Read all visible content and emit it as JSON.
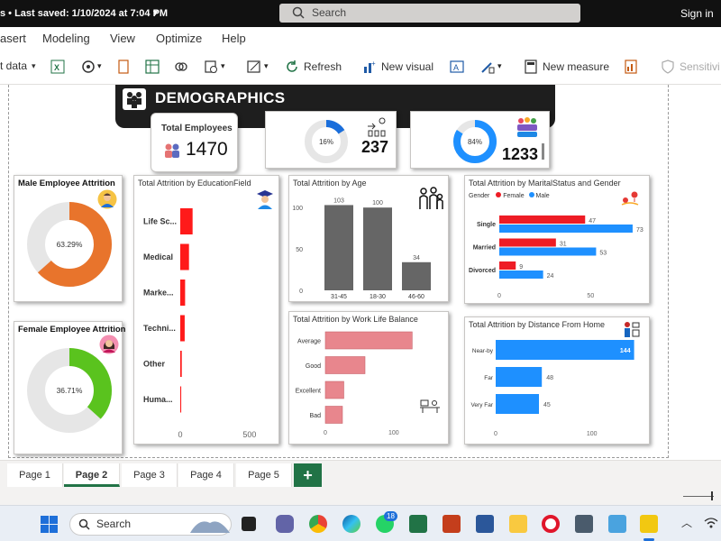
{
  "titlebar": {
    "saved_text": "s  •  Last saved: 1/10/2024 at 7:04 PM",
    "search_placeholder": "Search",
    "signin": "Sign in"
  },
  "menu": [
    "asert",
    "Modeling",
    "View",
    "Optimize",
    "Help"
  ],
  "ribbon": {
    "get_data": "t data",
    "refresh": "Refresh",
    "new_visual": "New visual",
    "new_measure": "New measure",
    "sensitivity": "Sensitivi"
  },
  "banner": {
    "title": "DEMOGRAPHICS"
  },
  "kpis": {
    "total_employees_label": "Total Employees",
    "total_employees_value": "1470",
    "attrition_count": "237",
    "attrition_pct": "16%",
    "active_count": "1233",
    "active_pct": "84%"
  },
  "colors": {
    "male": "#e8742c",
    "female": "#5ac31e",
    "education": "#ff1a1a",
    "age": "#666666",
    "worklife": "#e8868d",
    "distance": "#1e90ff",
    "marital_female": "#ee1c25",
    "marital_male": "#1e90ff",
    "donut_bg": "#e6e6e6",
    "kpi_blue": "#1a6edb",
    "kpi_blue2": "#1e90ff"
  },
  "male_attrition": {
    "title": "Male Employee Attrition",
    "value_label": "63.29%",
    "value": 63.29
  },
  "female_attrition": {
    "title": "Female Employee Attrition",
    "value_label": "36.71%",
    "value": 36.71
  },
  "chart_data": [
    {
      "type": "bar",
      "title": "Total Attrition by EducationField",
      "orientation": "horizontal",
      "categories": [
        "Life Sc...",
        "Medical",
        "Marke...",
        "Techni...",
        "Other",
        "Huma..."
      ],
      "values": [
        89,
        63,
        35,
        32,
        11,
        7
      ],
      "xticks": [
        "0",
        "500"
      ],
      "xlim": [
        0,
        650
      ]
    },
    {
      "type": "bar",
      "title": "Total Attrition by Age",
      "categories": [
        "31-45",
        "18-30",
        "46-60"
      ],
      "values": [
        103,
        100,
        34
      ],
      "yticks": [
        "0",
        "50",
        "100"
      ],
      "ylim": [
        0,
        110
      ]
    },
    {
      "type": "bar",
      "title": "Total Attrition by Work Life Balance",
      "orientation": "horizontal",
      "categories": [
        "Average",
        "Good",
        "Excellent",
        "Bad"
      ],
      "values": [
        127,
        58,
        27,
        25
      ],
      "xticks": [
        "0",
        "100"
      ],
      "xlim": [
        0,
        145
      ]
    },
    {
      "type": "bar",
      "title": "Total Attrition by MaritalStatus and Gender",
      "orientation": "horizontal",
      "legend_title": "Gender",
      "categories": [
        "Single",
        "Married",
        "Divorced"
      ],
      "series": [
        {
          "name": "Female",
          "values": [
            47,
            31,
            9
          ]
        },
        {
          "name": "Male",
          "values": [
            73,
            53,
            24
          ]
        }
      ],
      "xticks": [
        "0",
        "50"
      ],
      "xlim": [
        0,
        75
      ]
    },
    {
      "type": "bar",
      "title": "Total Attrition by Distance From Home",
      "orientation": "horizontal",
      "categories": [
        "Near-by",
        "Far",
        "Very Far"
      ],
      "values": [
        144,
        48,
        45
      ],
      "xticks": [
        "0",
        "100"
      ],
      "xlim": [
        0,
        150
      ]
    }
  ],
  "pages": [
    "Page 1",
    "Page 2",
    "Page 3",
    "Page 4",
    "Page 5"
  ],
  "active_page": "Page 2",
  "taskbar": {
    "search": "Search",
    "whatsapp_badge": "18"
  }
}
